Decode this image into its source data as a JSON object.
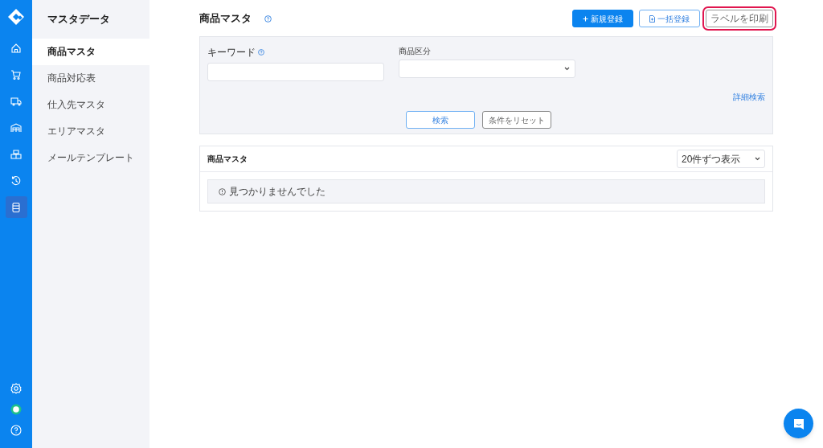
{
  "rail": {
    "items": [
      {
        "kind": "home",
        "selected": false
      },
      {
        "kind": "cart",
        "selected": false
      },
      {
        "kind": "truck",
        "selected": false
      },
      {
        "kind": "warehouse",
        "selected": false
      },
      {
        "kind": "boxes",
        "selected": false
      },
      {
        "kind": "history",
        "selected": false
      },
      {
        "kind": "database",
        "selected": true
      }
    ],
    "bottom": [
      {
        "kind": "settings"
      },
      {
        "kind": "status"
      },
      {
        "kind": "help"
      }
    ]
  },
  "sidebar": {
    "title": "マスタデータ",
    "items": [
      {
        "label": "商品マスタ",
        "selected": true
      },
      {
        "label": "商品対応表",
        "selected": false
      },
      {
        "label": "仕入先マスタ",
        "selected": false
      },
      {
        "label": "エリアマスタ",
        "selected": false
      },
      {
        "label": "メールテンプレート",
        "selected": false
      }
    ]
  },
  "page": {
    "title": "商品マスタ",
    "actions": [
      {
        "kind": "primary",
        "label": "新規登録",
        "highlighted": false
      },
      {
        "kind": "outline",
        "label": "一括登録",
        "highlighted": false
      },
      {
        "kind": "plain",
        "label": "ラベルを印刷",
        "highlighted": true
      }
    ]
  },
  "search": {
    "keyword_label": "キーワード",
    "category_label": "商品区分",
    "advanced_link": "詳細検索",
    "search_button": "検索",
    "reset_button": "条件をリセット"
  },
  "results": {
    "title": "商品マスタ",
    "page_size": "20件ずつ表示",
    "empty_message": "見つかりませんでした"
  }
}
